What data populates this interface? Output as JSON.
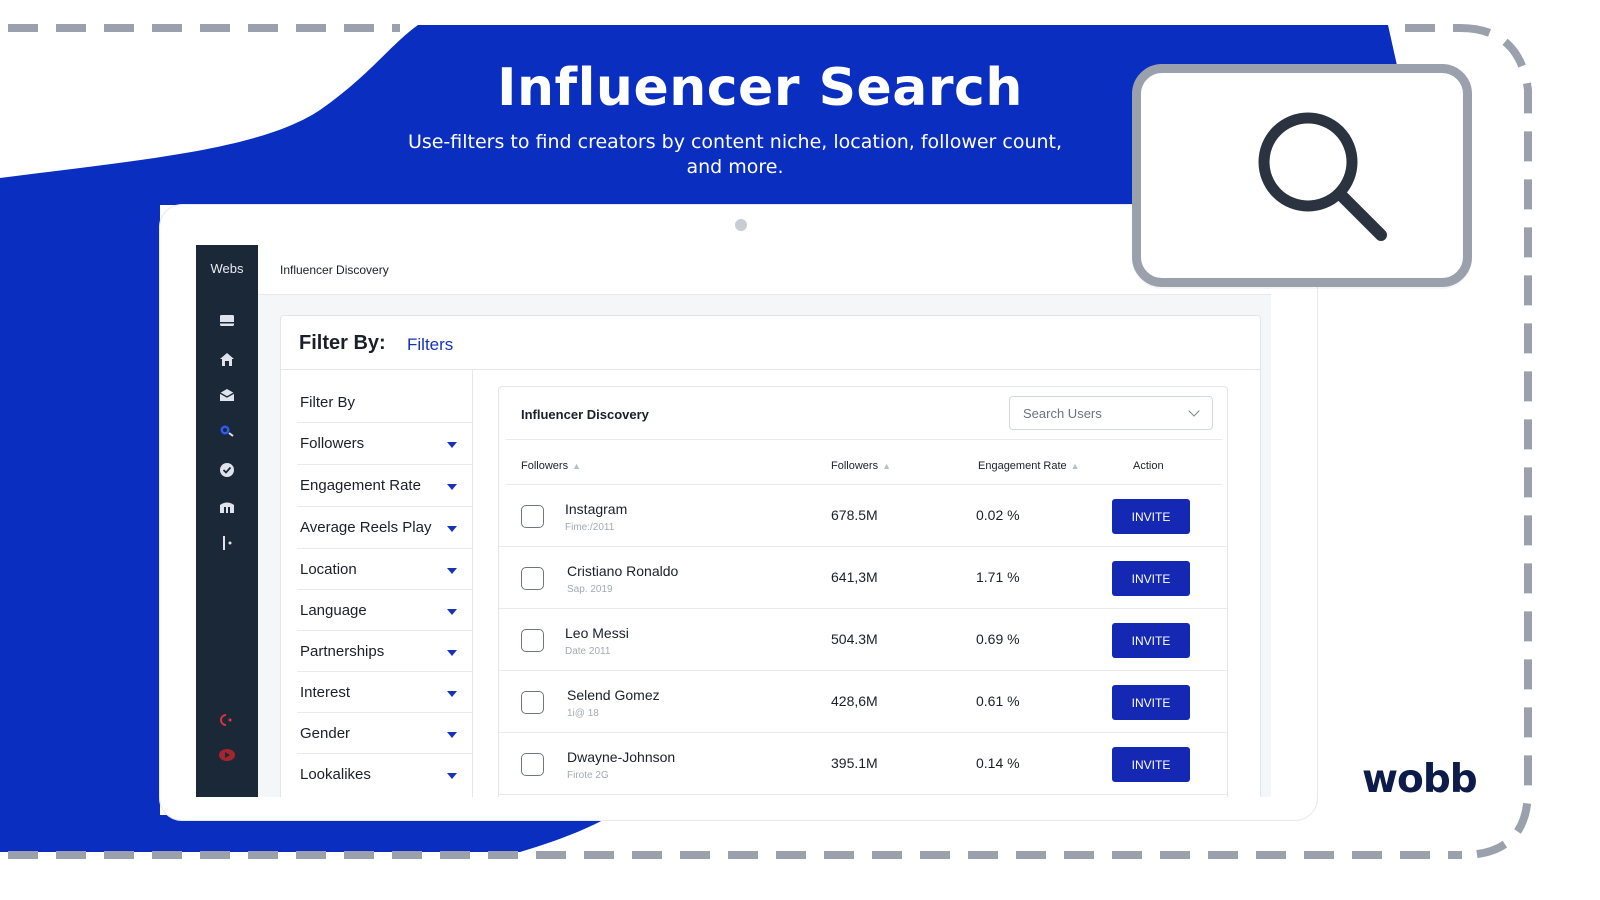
{
  "hero": {
    "title": "Influencer Search",
    "subtitle": "Use-filters to find creators by content niche, location, follower count, and more."
  },
  "colors": {
    "brand_blue": "#0a2ebf",
    "invite_button": "#1428b4",
    "sidebar": "#1b2838",
    "logo": "#0d1b4b",
    "dashed_frame": "#9aa1ad"
  },
  "sidebar": {
    "brand": "Webs",
    "icons": [
      "inbox-icon",
      "home-icon",
      "mailbox-icon",
      "search-user-icon",
      "check-circle-icon",
      "store-icon",
      "logout-bar-icon",
      "record-dot-icon",
      "video-icon"
    ]
  },
  "topbar": {
    "breadcrumb": "Influencer Discovery"
  },
  "filter_panel": {
    "label": "Filter By:",
    "link": "Filters",
    "list_title": "Filter By",
    "items": [
      "Followers",
      "Engagement Rate",
      "Average Reels Play",
      "Location",
      "Language",
      "Partnerships",
      "Interest",
      "Gender",
      "Lookalikes"
    ]
  },
  "table": {
    "title": "Influencer Discovery",
    "search_placeholder": "Search Users",
    "columns": [
      "Followers",
      "Followers",
      "Engagement Rate",
      "Action"
    ],
    "rows": [
      {
        "name": "Instagram",
        "sub": "Fime:/2011",
        "followers": "678.5M",
        "engagement": "0.02 %",
        "action": "INVITE"
      },
      {
        "name": "Cristiano Ronaldo",
        "sub": "Sap. 2019",
        "followers": "641,3M",
        "engagement": "1.71 %",
        "action": "INVITE"
      },
      {
        "name": "Leo Messi",
        "sub": "Date 2011",
        "followers": "504.3M",
        "engagement": "0.69 %",
        "action": "INVITE"
      },
      {
        "name": "Selend Gomez",
        "sub": "1i@ 18",
        "followers": "428,6M",
        "engagement": "0.61 %",
        "action": "INVITE"
      },
      {
        "name": "Dwayne-Johnson",
        "sub": "Firote 2G",
        "followers": "395.1M",
        "engagement": "0.14 %",
        "action": "INVITE"
      }
    ]
  },
  "logo": "wobb"
}
